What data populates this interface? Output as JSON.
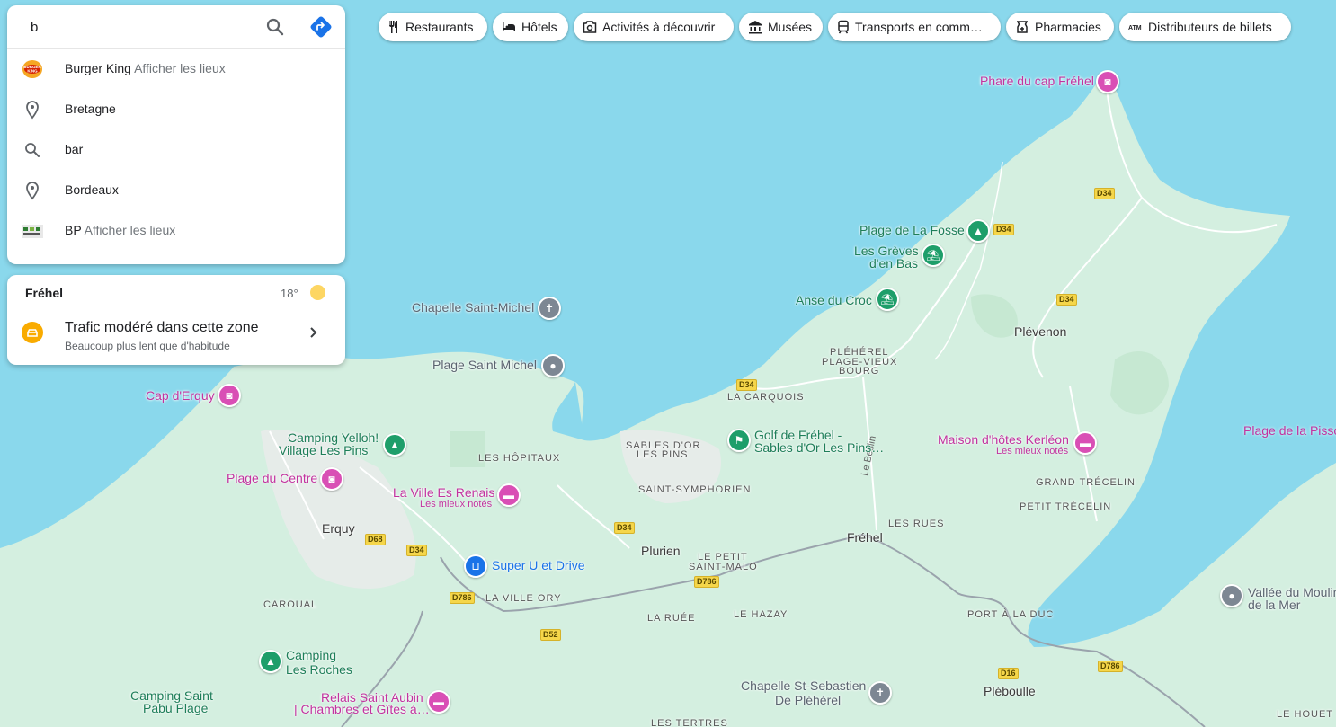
{
  "search": {
    "value": "b",
    "suggestions": [
      {
        "icon": "burger-king-logo",
        "bold": "B",
        "rest": "urger King",
        "hint": "Afficher les lieux"
      },
      {
        "icon": "place-pin-icon",
        "bold": "B",
        "rest": "retagne",
        "hint": ""
      },
      {
        "icon": "search-icon",
        "bold": "b",
        "rest": "ar",
        "hint": ""
      },
      {
        "icon": "place-pin-icon",
        "bold": "B",
        "rest": "ordeaux",
        "hint": ""
      },
      {
        "icon": "bp-logo",
        "bold": "B",
        "rest": "P",
        "hint": "Afficher les lieux"
      }
    ]
  },
  "traffic_card": {
    "place": "Fréhel",
    "temperature": "18°",
    "title": "Trafic modéré dans cette zone",
    "subtitle": "Beaucoup plus lent que d'habitude"
  },
  "chips": [
    {
      "icon": "restaurant-icon",
      "label": "Restaurants"
    },
    {
      "icon": "hotel-icon",
      "label": "Hôtels"
    },
    {
      "icon": "camera-icon",
      "label": "Activités à découvrir"
    },
    {
      "icon": "museum-icon",
      "label": "Musées"
    },
    {
      "icon": "transit-icon",
      "label": "Transports en comm…"
    },
    {
      "icon": "pharmacy-icon",
      "label": "Pharmacies"
    },
    {
      "icon": "atm-icon",
      "label": "Distributeurs de billets"
    }
  ],
  "map": {
    "towns": [
      "Erquy",
      "Plurien",
      "Fréhel",
      "Plévenon",
      "Pléboulle"
    ],
    "villages": [
      "Les Hôpitaux",
      "Sables d'Or",
      "les Pins",
      "Saint-Symphorien",
      "La Carquois",
      "Pléhérel",
      "Plage-Vieux",
      "Bourg",
      "Le Petit",
      "Saint-Malo",
      "La Ville Ory",
      "La Ruée",
      "Le Hazay",
      "Les Rues",
      "Grand Trécelin",
      "Petit Trécelin",
      "Port à la Duc",
      "Caroual",
      "Les Tertres",
      "Le Houet"
    ],
    "roads": [
      "D34",
      "D34",
      "D34",
      "D34",
      "D34",
      "D68",
      "D34",
      "D786",
      "D786",
      "D786",
      "D52",
      "D16"
    ],
    "road_name": "Le Beslin",
    "pois": {
      "phare": "Phare du cap Fréhel",
      "plage_fosse": "Plage de La Fosse",
      "greves_1": "Les Grèves",
      "greves_2": "d'en Bas",
      "anse": "Anse du Croc",
      "chapelle_st_michel": "Chapelle Saint-Michel",
      "plage_st_michel": "Plage Saint Michel",
      "cap_erquy": "Cap d'Erquy",
      "camping_yelloh_1": "Camping Yelloh!",
      "camping_yelloh_2": "Village Les Pins",
      "plage_centre": "Plage du Centre",
      "ville_es_renais": "La Ville Es Renais",
      "ville_es_renais_sub": "Les mieux notés",
      "golf_1": "Golf de Fréhel -",
      "golf_2": "Sables d'Or Les Pins…",
      "maison_kerleon": "Maison d'hôtes Kerléon",
      "maison_kerleon_sub": "Les mieux notés",
      "plage_pissot": "Plage de la Pisso",
      "super_u": "Super U et Drive",
      "vallee_1": "Vallée du Moulin",
      "vallee_2": "de la Mer",
      "camping_roches_1": "Camping",
      "camping_roches_2": "Les Roches",
      "camping_pabu_1": "Camping Saint",
      "camping_pabu_2": "Pabu Plage",
      "relais_1": "Relais Saint Aubin",
      "relais_2": "| Chambres et Gîtes à…",
      "chapelle_seb_1": "Chapelle St-Sebastien",
      "chapelle_seb_2": "De Pléhérel"
    }
  },
  "colors": {
    "water": "#8ad8ec",
    "land": "#d4efe0",
    "green_poi": "#1e9e6a",
    "pink_poi": "#d94fb5",
    "road_yellow": "#f5d64a"
  }
}
